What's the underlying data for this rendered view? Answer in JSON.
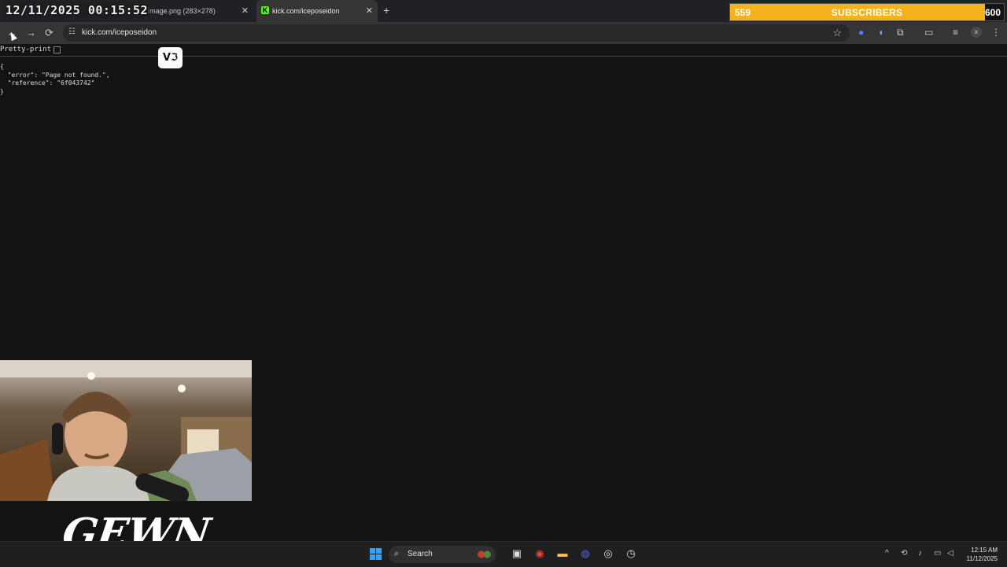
{
  "overlay": {
    "timestamp": "12/11/2025 00:15:52",
    "subscribers": {
      "current": "559",
      "label": "SUBSCRIBERS",
      "goal": "600",
      "progress": 0.931
    },
    "watermark": "GEWN",
    "badge": "V"
  },
  "tabs": [
    {
      "title": "image.png (283×278)",
      "close": "✕"
    },
    {
      "title": "kick.com/iceposeidon",
      "favicon": "K",
      "close": "✕"
    }
  ],
  "toolbar": {
    "url": "kick.com/iceposeidon",
    "back_icon": "←",
    "forward_icon": "→",
    "reload_icon": "⟳"
  },
  "page": {
    "pretty_print_label": "Pretty-print",
    "json_text": "{\n  \"error\": \"Page not found.\",\n  \"reference\": \"6f043742\"\n}"
  },
  "taskbar": {
    "search_label": "Search",
    "time": "12:15 AM",
    "date": "11/12/2025"
  },
  "colors": {
    "subscriber_bar": "#f5b21a",
    "kick_green": "#53fc18",
    "background": "#131313"
  }
}
